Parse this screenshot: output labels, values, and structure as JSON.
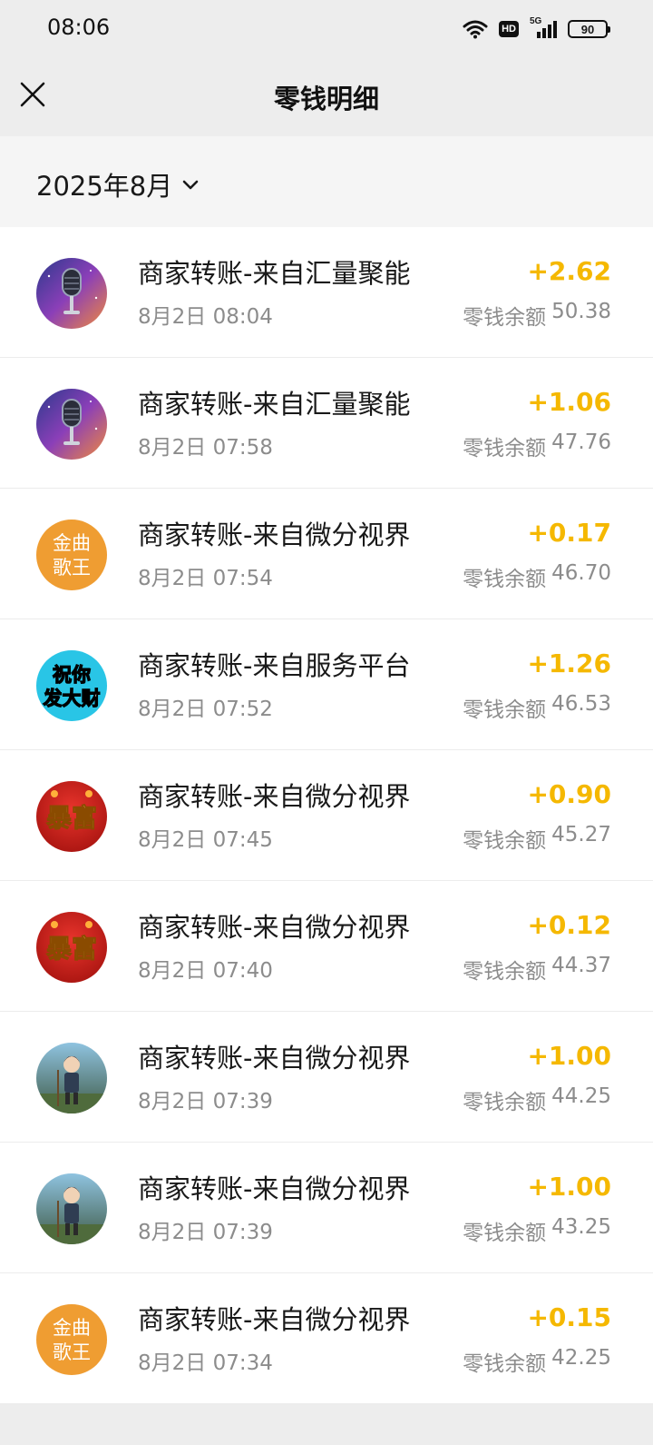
{
  "status_bar": {
    "time": "08:06",
    "battery": "90",
    "network": "5G",
    "hd_label": "HD"
  },
  "header": {
    "title": "零钱明细",
    "close_icon": "close-icon"
  },
  "filter": {
    "month": "2025年8月"
  },
  "colors": {
    "amount": "#f5b800",
    "secondary_text": "#8c8c8c",
    "header_bg": "#ededed"
  },
  "transactions": [
    {
      "title": "商家转账-来自汇量聚能",
      "time": "8月2日 08:04",
      "amount": "+2.62",
      "balance_label": "零钱余额",
      "balance": "50.38",
      "avatar": "microphone-avatar"
    },
    {
      "title": "商家转账-来自汇量聚能",
      "time": "8月2日 07:58",
      "amount": "+1.06",
      "balance_label": "零钱余额",
      "balance": "47.76",
      "avatar": "microphone-avatar"
    },
    {
      "title": "商家转账-来自微分视界",
      "time": "8月2日 07:54",
      "amount": "+0.17",
      "balance_label": "零钱余额",
      "balance": "46.70",
      "avatar": "text-avatar",
      "avatar_text": [
        "金曲",
        "歌王"
      ]
    },
    {
      "title": "商家转账-来自服务平台",
      "time": "8月2日 07:52",
      "amount": "+1.26",
      "balance_label": "零钱余额",
      "balance": "46.53",
      "avatar": "text-avatar",
      "avatar_text": [
        "祝你",
        "发大财"
      ]
    },
    {
      "title": "商家转账-来自微分视界",
      "time": "8月2日 07:45",
      "amount": "+0.90",
      "balance_label": "零钱余额",
      "balance": "45.27",
      "avatar": "text-avatar",
      "avatar_text": [
        "暴富"
      ]
    },
    {
      "title": "商家转账-来自微分视界",
      "time": "8月2日 07:40",
      "amount": "+0.12",
      "balance_label": "零钱余额",
      "balance": "44.37",
      "avatar": "text-avatar",
      "avatar_text": [
        "暴富"
      ]
    },
    {
      "title": "商家转账-来自微分视界",
      "time": "8月2日 07:39",
      "amount": "+1.00",
      "balance_label": "零钱余额",
      "balance": "44.25",
      "avatar": "character-avatar"
    },
    {
      "title": "商家转账-来自微分视界",
      "time": "8月2日 07:39",
      "amount": "+1.00",
      "balance_label": "零钱余额",
      "balance": "43.25",
      "avatar": "character-avatar"
    },
    {
      "title": "商家转账-来自微分视界",
      "time": "8月2日 07:34",
      "amount": "+0.15",
      "balance_label": "零钱余额",
      "balance": "42.25",
      "avatar": "text-avatar",
      "avatar_text": [
        "金曲",
        "歌王"
      ]
    }
  ]
}
